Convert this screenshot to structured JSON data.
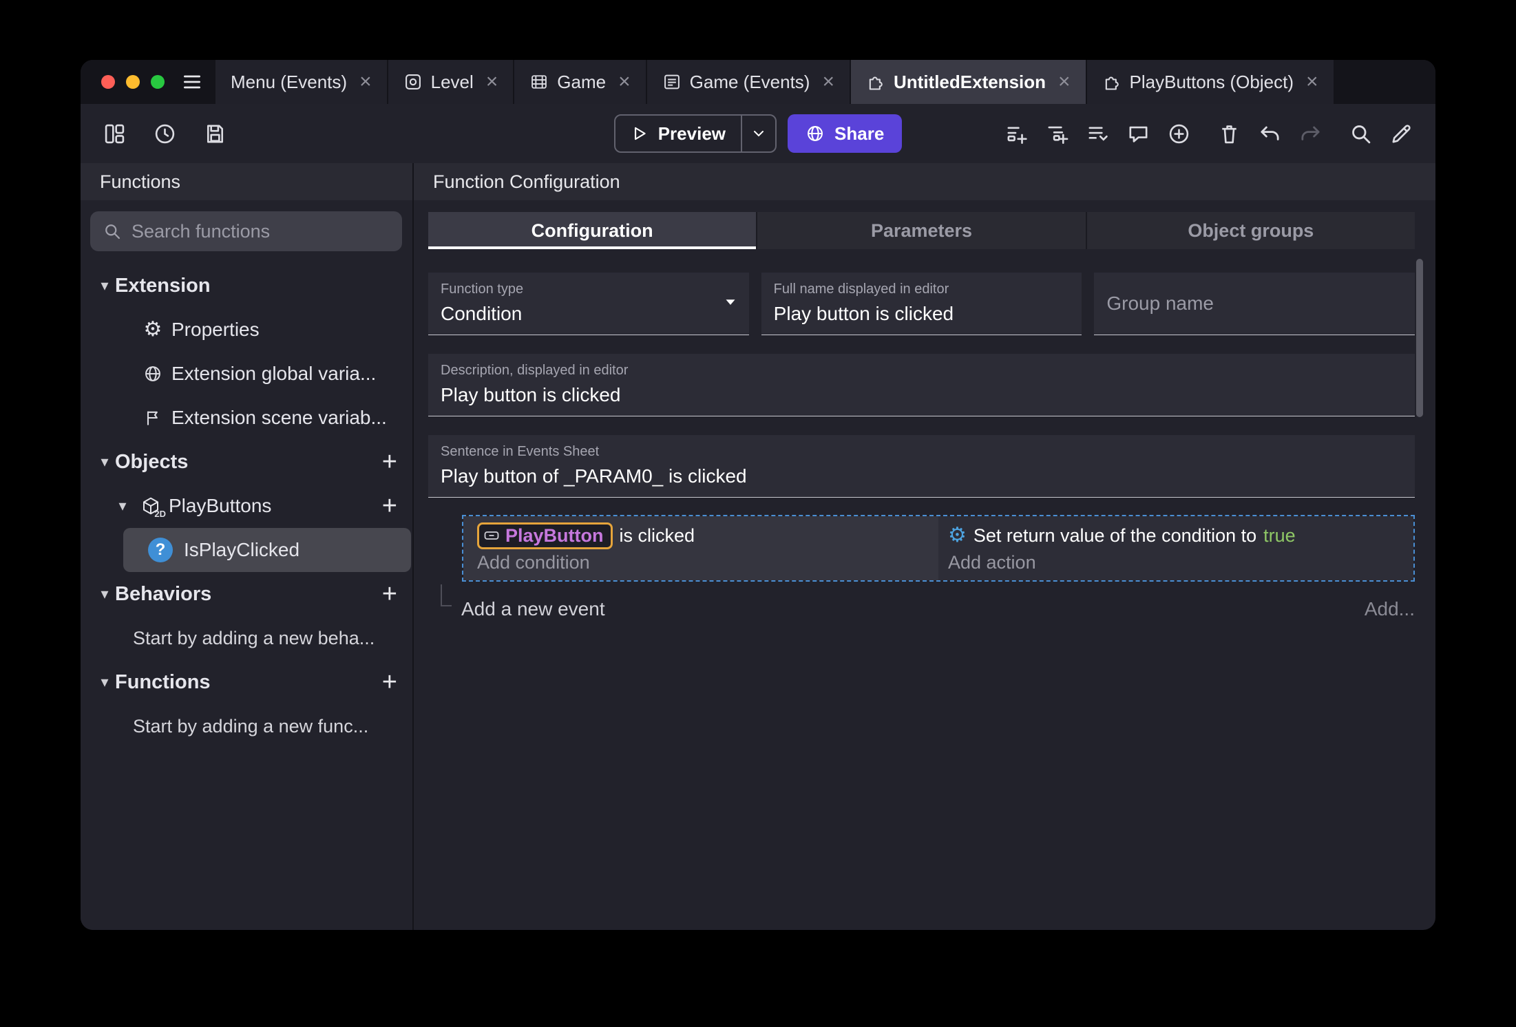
{
  "icons": {
    "close": "×",
    "plus": "+",
    "caret_down": "▾",
    "gear": "⚙",
    "question": "?",
    "cube_sub": "2D"
  },
  "window_tabs": [
    {
      "label": "Menu (Events)"
    },
    {
      "label": "Level"
    },
    {
      "label": "Game"
    },
    {
      "label": "Game (Events)"
    },
    {
      "label": "UntitledExtension"
    },
    {
      "label": "PlayButtons (Object)"
    }
  ],
  "toolbar": {
    "preview": "Preview",
    "share": "Share"
  },
  "sidebar": {
    "title": "Functions",
    "search_placeholder": "Search functions",
    "extension_label": "Extension",
    "extension_items": [
      {
        "label": "Properties"
      },
      {
        "label": "Extension global varia..."
      },
      {
        "label": "Extension scene variab..."
      }
    ],
    "objects_label": "Objects",
    "playbuttons_label": "PlayButtons",
    "function_item_label": "IsPlayClicked",
    "behaviors_label": "Behaviors",
    "behaviors_hint": "Start by adding a new beha...",
    "functions_label": "Functions",
    "functions_hint": "Start by adding a new func..."
  },
  "main": {
    "title": "Function Configuration",
    "tabs": [
      {
        "label": "Configuration"
      },
      {
        "label": "Parameters"
      },
      {
        "label": "Object groups"
      }
    ],
    "function_type_label": "Function type",
    "function_type_value": "Condition",
    "full_name_label": "Full name displayed in editor",
    "full_name_value": "Play button is clicked",
    "group_name_placeholder": "Group name",
    "description_label": "Description, displayed in editor",
    "description_value": "Play button is clicked",
    "sentence_label": "Sentence in Events Sheet",
    "sentence_value": "Play button of _PARAM0_ is clicked"
  },
  "events": {
    "condition_object": "PlayButton",
    "condition_text": "is clicked",
    "add_condition": "Add condition",
    "action_text": "Set return value of the condition to",
    "action_value": "true",
    "add_action": "Add action",
    "add_event": "Add a new event",
    "add_more": "Add..."
  },
  "colors": {
    "accent_purple": "#5a43d9",
    "selection_blue": "#4a8fd4",
    "token_border_orange": "#e5a43b",
    "token_text_purple": "#c678dd",
    "true_green": "#8fc866",
    "tab_active_bg": "#3a3a45"
  }
}
